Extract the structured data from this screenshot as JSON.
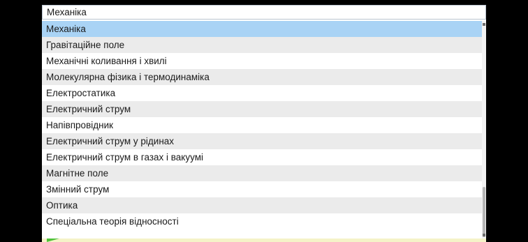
{
  "select": {
    "value": "Механіка"
  },
  "options": [
    "Механіка",
    "Гравітаційне поле",
    "Механічні коливання і хвилі",
    "Молекулярна фізика і термодинаміка",
    "Електростатика",
    "Електричний струм",
    "Напівпровідник",
    "Електричний струм у рідинах",
    "Електричний струм в газах і вакуумі",
    "Магнітне поле",
    "Змінний струм",
    "Оптика",
    "Спеціальна теорія відносності"
  ],
  "selected_index": 0,
  "scrollbar": {
    "position_fraction": 0.78
  },
  "colors": {
    "background": "#000000",
    "selected": "#a9d3f5",
    "stripe": "#ebebeb",
    "accent_green": "#4fc23a"
  },
  "icons": {
    "scroll_up": "scroll-up-arrow-icon",
    "scroll_down": "scroll-down-arrow-icon",
    "green_marker": "green-triangle-icon"
  }
}
